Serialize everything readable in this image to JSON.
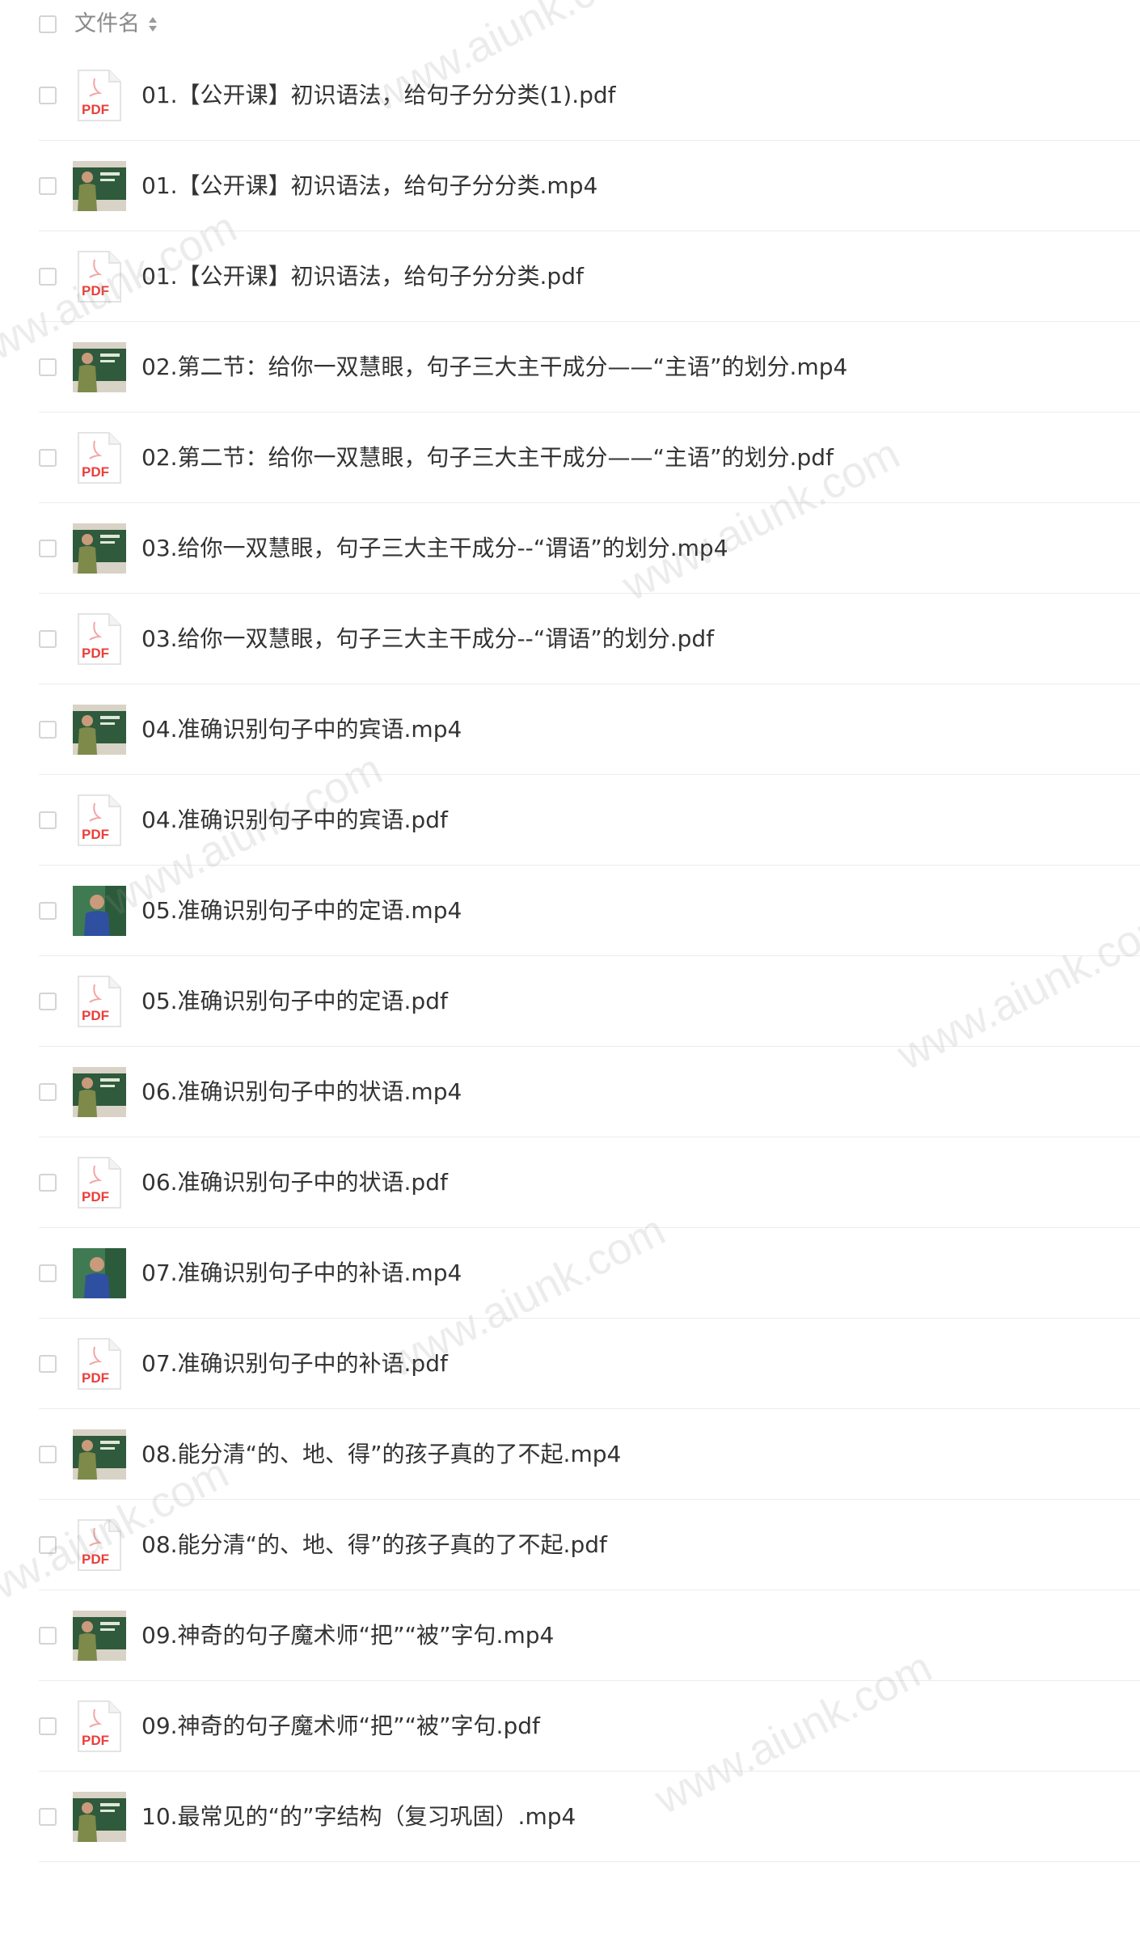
{
  "header": {
    "column_label": "文件名",
    "sort_icon": "sort-updown-icon"
  },
  "files": [
    {
      "name": "01.【公开课】初识语法，给句子分分类(1).pdf",
      "type": "pdf",
      "icon": "pdf-file-icon"
    },
    {
      "name": "01.【公开课】初识语法，给句子分分类.mp4",
      "type": "video",
      "icon": "video-thumbnail",
      "thumb": "board"
    },
    {
      "name": "01.【公开课】初识语法，给句子分分类.pdf",
      "type": "pdf",
      "icon": "pdf-file-icon"
    },
    {
      "name": "02.第二节：给你一双慧眼，句子三大主干成分——“主语”的划分.mp4",
      "type": "video",
      "icon": "video-thumbnail",
      "thumb": "board"
    },
    {
      "name": "02.第二节：给你一双慧眼，句子三大主干成分——“主语”的划分.pdf",
      "type": "pdf",
      "icon": "pdf-file-icon"
    },
    {
      "name": "03.给你一双慧眼，句子三大主干成分--“谓语”的划分.mp4",
      "type": "video",
      "icon": "video-thumbnail",
      "thumb": "board"
    },
    {
      "name": "03.给你一双慧眼，句子三大主干成分--“谓语”的划分.pdf",
      "type": "pdf",
      "icon": "pdf-file-icon"
    },
    {
      "name": "04.准确识别句子中的宾语.mp4",
      "type": "video",
      "icon": "video-thumbnail",
      "thumb": "board"
    },
    {
      "name": "04.准确识别句子中的宾语.pdf",
      "type": "pdf",
      "icon": "pdf-file-icon"
    },
    {
      "name": "05.准确识别句子中的定语.mp4",
      "type": "video",
      "icon": "video-thumbnail",
      "thumb": "blue"
    },
    {
      "name": "05.准确识别句子中的定语.pdf",
      "type": "pdf",
      "icon": "pdf-file-icon"
    },
    {
      "name": "06.准确识别句子中的状语.mp4",
      "type": "video",
      "icon": "video-thumbnail",
      "thumb": "board"
    },
    {
      "name": "06.准确识别句子中的状语.pdf",
      "type": "pdf",
      "icon": "pdf-file-icon"
    },
    {
      "name": "07.准确识别句子中的补语.mp4",
      "type": "video",
      "icon": "video-thumbnail",
      "thumb": "blue"
    },
    {
      "name": "07.准确识别句子中的补语.pdf",
      "type": "pdf",
      "icon": "pdf-file-icon"
    },
    {
      "name": "08.能分清“的、地、得”的孩子真的了不起.mp4",
      "type": "video",
      "icon": "video-thumbnail",
      "thumb": "board"
    },
    {
      "name": "08.能分清“的、地、得”的孩子真的了不起.pdf",
      "type": "pdf",
      "icon": "pdf-file-icon"
    },
    {
      "name": "09.神奇的句子魔术师“把”“被”字句.mp4",
      "type": "video",
      "icon": "video-thumbnail",
      "thumb": "board"
    },
    {
      "name": "09.神奇的句子魔术师“把”“被”字句.pdf",
      "type": "pdf",
      "icon": "pdf-file-icon"
    },
    {
      "name": "10.最常见的“的”字结构（复习巩固）.mp4",
      "type": "video",
      "icon": "video-thumbnail",
      "thumb": "board"
    }
  ],
  "pdf_icon_label": "PDF",
  "watermark_text": "www.aiunk.com",
  "colors": {
    "pdf_red": "#e8403c",
    "board_green": "#2f5a3c",
    "text": "#333333",
    "header_text": "#8a8a8a",
    "watermark": "rgba(150,150,150,0.18)"
  }
}
